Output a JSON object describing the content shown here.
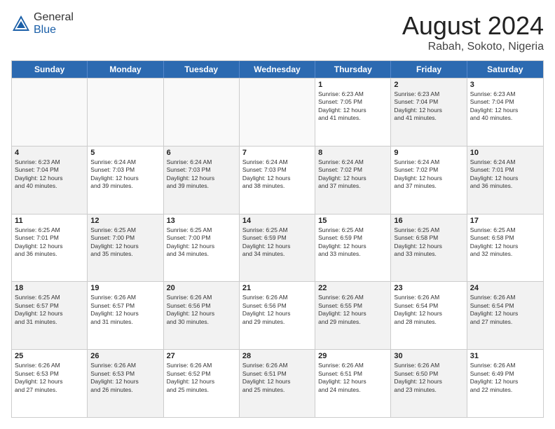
{
  "header": {
    "logo_general": "General",
    "logo_blue": "Blue",
    "month_title": "August 2024",
    "location": "Rabah, Sokoto, Nigeria"
  },
  "weekdays": [
    "Sunday",
    "Monday",
    "Tuesday",
    "Wednesday",
    "Thursday",
    "Friday",
    "Saturday"
  ],
  "rows": [
    [
      {
        "day": "",
        "info": "",
        "shaded": false,
        "empty": true
      },
      {
        "day": "",
        "info": "",
        "shaded": false,
        "empty": true
      },
      {
        "day": "",
        "info": "",
        "shaded": false,
        "empty": true
      },
      {
        "day": "",
        "info": "",
        "shaded": false,
        "empty": true
      },
      {
        "day": "1",
        "info": "Sunrise: 6:23 AM\nSunset: 7:05 PM\nDaylight: 12 hours\nand 41 minutes.",
        "shaded": false,
        "empty": false
      },
      {
        "day": "2",
        "info": "Sunrise: 6:23 AM\nSunset: 7:04 PM\nDaylight: 12 hours\nand 41 minutes.",
        "shaded": true,
        "empty": false
      },
      {
        "day": "3",
        "info": "Sunrise: 6:23 AM\nSunset: 7:04 PM\nDaylight: 12 hours\nand 40 minutes.",
        "shaded": false,
        "empty": false
      }
    ],
    [
      {
        "day": "4",
        "info": "Sunrise: 6:23 AM\nSunset: 7:04 PM\nDaylight: 12 hours\nand 40 minutes.",
        "shaded": true,
        "empty": false
      },
      {
        "day": "5",
        "info": "Sunrise: 6:24 AM\nSunset: 7:03 PM\nDaylight: 12 hours\nand 39 minutes.",
        "shaded": false,
        "empty": false
      },
      {
        "day": "6",
        "info": "Sunrise: 6:24 AM\nSunset: 7:03 PM\nDaylight: 12 hours\nand 39 minutes.",
        "shaded": true,
        "empty": false
      },
      {
        "day": "7",
        "info": "Sunrise: 6:24 AM\nSunset: 7:03 PM\nDaylight: 12 hours\nand 38 minutes.",
        "shaded": false,
        "empty": false
      },
      {
        "day": "8",
        "info": "Sunrise: 6:24 AM\nSunset: 7:02 PM\nDaylight: 12 hours\nand 37 minutes.",
        "shaded": true,
        "empty": false
      },
      {
        "day": "9",
        "info": "Sunrise: 6:24 AM\nSunset: 7:02 PM\nDaylight: 12 hours\nand 37 minutes.",
        "shaded": false,
        "empty": false
      },
      {
        "day": "10",
        "info": "Sunrise: 6:24 AM\nSunset: 7:01 PM\nDaylight: 12 hours\nand 36 minutes.",
        "shaded": true,
        "empty": false
      }
    ],
    [
      {
        "day": "11",
        "info": "Sunrise: 6:25 AM\nSunset: 7:01 PM\nDaylight: 12 hours\nand 36 minutes.",
        "shaded": false,
        "empty": false
      },
      {
        "day": "12",
        "info": "Sunrise: 6:25 AM\nSunset: 7:00 PM\nDaylight: 12 hours\nand 35 minutes.",
        "shaded": true,
        "empty": false
      },
      {
        "day": "13",
        "info": "Sunrise: 6:25 AM\nSunset: 7:00 PM\nDaylight: 12 hours\nand 34 minutes.",
        "shaded": false,
        "empty": false
      },
      {
        "day": "14",
        "info": "Sunrise: 6:25 AM\nSunset: 6:59 PM\nDaylight: 12 hours\nand 34 minutes.",
        "shaded": true,
        "empty": false
      },
      {
        "day": "15",
        "info": "Sunrise: 6:25 AM\nSunset: 6:59 PM\nDaylight: 12 hours\nand 33 minutes.",
        "shaded": false,
        "empty": false
      },
      {
        "day": "16",
        "info": "Sunrise: 6:25 AM\nSunset: 6:58 PM\nDaylight: 12 hours\nand 33 minutes.",
        "shaded": true,
        "empty": false
      },
      {
        "day": "17",
        "info": "Sunrise: 6:25 AM\nSunset: 6:58 PM\nDaylight: 12 hours\nand 32 minutes.",
        "shaded": false,
        "empty": false
      }
    ],
    [
      {
        "day": "18",
        "info": "Sunrise: 6:25 AM\nSunset: 6:57 PM\nDaylight: 12 hours\nand 31 minutes.",
        "shaded": true,
        "empty": false
      },
      {
        "day": "19",
        "info": "Sunrise: 6:26 AM\nSunset: 6:57 PM\nDaylight: 12 hours\nand 31 minutes.",
        "shaded": false,
        "empty": false
      },
      {
        "day": "20",
        "info": "Sunrise: 6:26 AM\nSunset: 6:56 PM\nDaylight: 12 hours\nand 30 minutes.",
        "shaded": true,
        "empty": false
      },
      {
        "day": "21",
        "info": "Sunrise: 6:26 AM\nSunset: 6:56 PM\nDaylight: 12 hours\nand 29 minutes.",
        "shaded": false,
        "empty": false
      },
      {
        "day": "22",
        "info": "Sunrise: 6:26 AM\nSunset: 6:55 PM\nDaylight: 12 hours\nand 29 minutes.",
        "shaded": true,
        "empty": false
      },
      {
        "day": "23",
        "info": "Sunrise: 6:26 AM\nSunset: 6:54 PM\nDaylight: 12 hours\nand 28 minutes.",
        "shaded": false,
        "empty": false
      },
      {
        "day": "24",
        "info": "Sunrise: 6:26 AM\nSunset: 6:54 PM\nDaylight: 12 hours\nand 27 minutes.",
        "shaded": true,
        "empty": false
      }
    ],
    [
      {
        "day": "25",
        "info": "Sunrise: 6:26 AM\nSunset: 6:53 PM\nDaylight: 12 hours\nand 27 minutes.",
        "shaded": false,
        "empty": false
      },
      {
        "day": "26",
        "info": "Sunrise: 6:26 AM\nSunset: 6:53 PM\nDaylight: 12 hours\nand 26 minutes.",
        "shaded": true,
        "empty": false
      },
      {
        "day": "27",
        "info": "Sunrise: 6:26 AM\nSunset: 6:52 PM\nDaylight: 12 hours\nand 25 minutes.",
        "shaded": false,
        "empty": false
      },
      {
        "day": "28",
        "info": "Sunrise: 6:26 AM\nSunset: 6:51 PM\nDaylight: 12 hours\nand 25 minutes.",
        "shaded": true,
        "empty": false
      },
      {
        "day": "29",
        "info": "Sunrise: 6:26 AM\nSunset: 6:51 PM\nDaylight: 12 hours\nand 24 minutes.",
        "shaded": false,
        "empty": false
      },
      {
        "day": "30",
        "info": "Sunrise: 6:26 AM\nSunset: 6:50 PM\nDaylight: 12 hours\nand 23 minutes.",
        "shaded": true,
        "empty": false
      },
      {
        "day": "31",
        "info": "Sunrise: 6:26 AM\nSunset: 6:49 PM\nDaylight: 12 hours\nand 22 minutes.",
        "shaded": false,
        "empty": false
      }
    ]
  ]
}
